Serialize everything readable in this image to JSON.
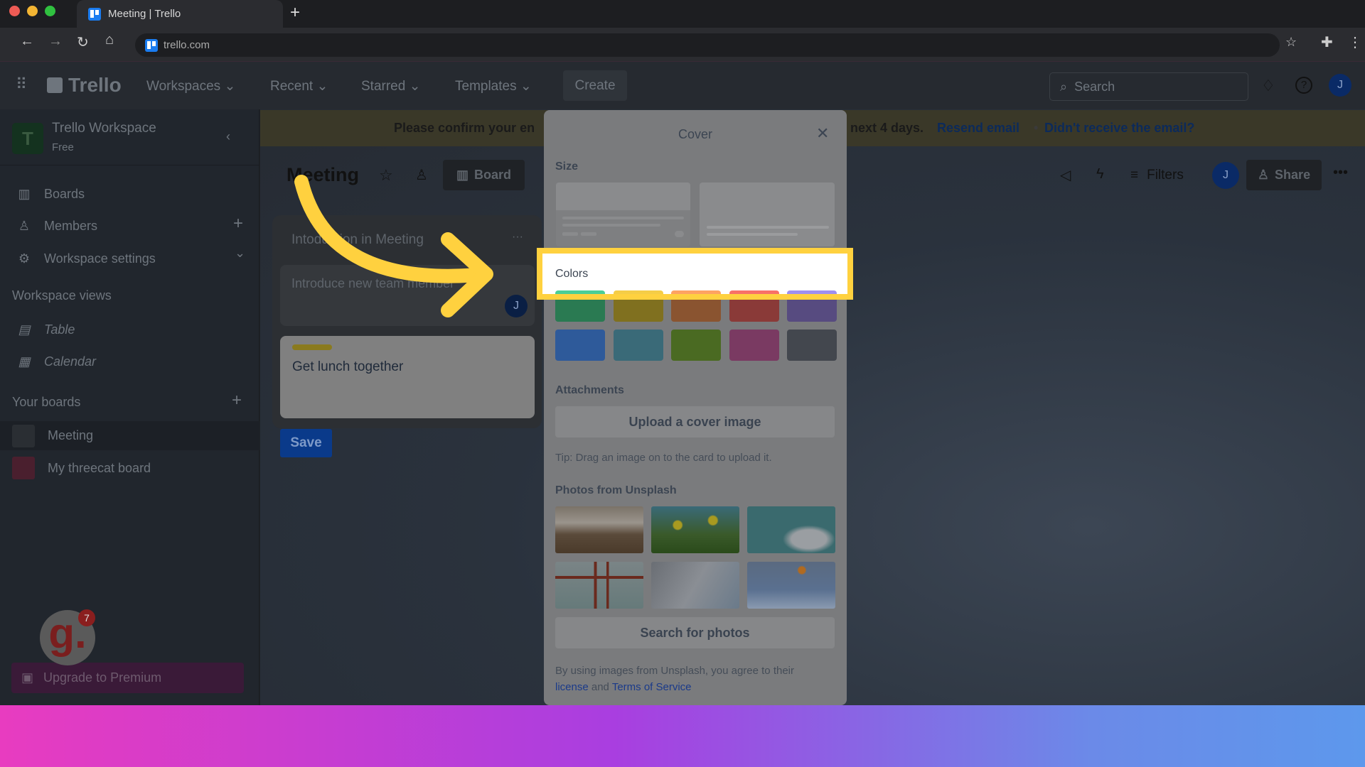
{
  "browser": {
    "tab_title": "Meeting | Trello",
    "url": "trello.com",
    "new_tab": "+"
  },
  "header": {
    "logo": "Trello",
    "menus": [
      "Workspaces",
      "Recent",
      "Starred",
      "Templates"
    ],
    "create": "Create",
    "search_placeholder": "Search",
    "avatar": "J"
  },
  "sidebar": {
    "workspace_initial": "T",
    "workspace_name": "Trello Workspace",
    "plan": "Free",
    "items": [
      {
        "label": "Boards",
        "icon": "board-icon"
      },
      {
        "label": "Members",
        "icon": "person-icon"
      },
      {
        "label": "Workspace settings",
        "icon": "gear-icon"
      }
    ],
    "views_heading": "Workspace views",
    "views": [
      {
        "label": "Table",
        "icon": "table-icon"
      },
      {
        "label": "Calendar",
        "icon": "calendar-icon"
      }
    ],
    "boards_heading": "Your boards",
    "boards": [
      {
        "label": "Meeting",
        "color": "#2a2e33"
      },
      {
        "label": "My threecat board",
        "color": "#4a1f2e"
      }
    ],
    "upgrade": "Upgrade to Premium",
    "grammarly_badge": "7"
  },
  "banner": {
    "text_left": "Please confirm your en",
    "text_right": "next 4 days.",
    "resend": "Resend email",
    "separator": "•",
    "didnt": "Didn't receive the email?"
  },
  "board": {
    "title": "Meeting",
    "view": "Board",
    "filters": "Filters",
    "share": "Share",
    "avatar": "J",
    "list": {
      "title": "Intoduction in Meeting",
      "cards": [
        {
          "text": "Introduce new team member",
          "avatar": "J"
        },
        {
          "text": "Get lunch together",
          "label_color": "#8a7a1e"
        }
      ],
      "save": "Save"
    }
  },
  "cover_popup": {
    "title": "Cover",
    "size_label": "Size",
    "colors_label": "Colors",
    "colors": [
      "#2a7a52",
      "#80701f",
      "#8a5430",
      "#8a3a38",
      "#574b80",
      "#2e5a9a",
      "#3a6a78",
      "#4a6a22",
      "#7a3a62",
      "#43474e"
    ],
    "colors_top": [
      "#4bce97",
      "#f5cd47",
      "#fea362",
      "#f87168",
      "#9f8fef"
    ],
    "attachments_label": "Attachments",
    "upload": "Upload a cover image",
    "tip": "Tip: Drag an image on to the card to upload it.",
    "unsplash_label": "Photos from Unsplash",
    "photos": [
      "mountains",
      "sunflowers",
      "heron",
      "torii-gate",
      "cliff",
      "orange-flower"
    ],
    "search": "Search for photos",
    "footer": "By using images from Unsplash, you agree to their",
    "license": "license",
    "and": "and",
    "terms": "Terms of Service"
  },
  "highlight_color": "#ffd13f"
}
